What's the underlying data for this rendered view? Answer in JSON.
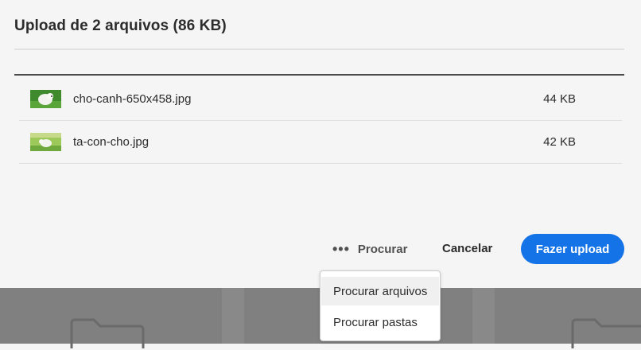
{
  "dialog": {
    "title": "Upload de 2 arquivos (86 KB)"
  },
  "files": [
    {
      "name": "cho-canh-650x458.jpg",
      "size": "44 KB",
      "thumb_icon": "image-thumbnail-icon"
    },
    {
      "name": "ta-con-cho.jpg",
      "size": "42 KB",
      "thumb_icon": "image-thumbnail-icon"
    }
  ],
  "actions": {
    "browse_label": "Procurar",
    "browse_icon": "more-icon",
    "cancel_label": "Cancelar",
    "upload_label": "Fazer upload"
  },
  "browse_menu": {
    "items": [
      "Procurar arquivos",
      "Procurar pastas"
    ],
    "highlighted_index": 0
  },
  "colors": {
    "accent": "#1473e6",
    "dialog_bg": "#f5f5f5",
    "overlay_bg": "#7c7c7c"
  }
}
